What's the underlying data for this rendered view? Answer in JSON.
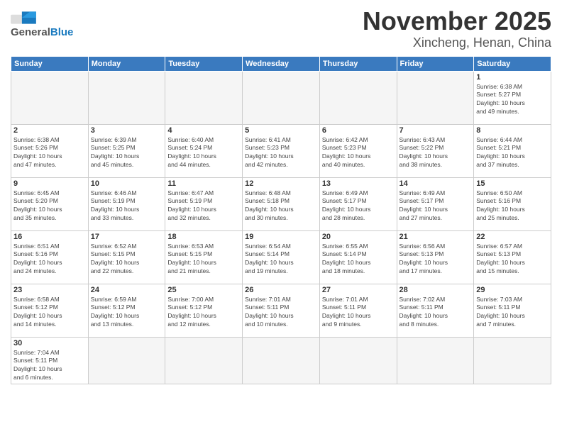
{
  "header": {
    "logo_general": "General",
    "logo_blue": "Blue",
    "month_title": "November 2025",
    "location": "Xincheng, Henan, China"
  },
  "weekdays": [
    "Sunday",
    "Monday",
    "Tuesday",
    "Wednesday",
    "Thursday",
    "Friday",
    "Saturday"
  ],
  "weeks": [
    [
      {
        "day": "",
        "info": ""
      },
      {
        "day": "",
        "info": ""
      },
      {
        "day": "",
        "info": ""
      },
      {
        "day": "",
        "info": ""
      },
      {
        "day": "",
        "info": ""
      },
      {
        "day": "",
        "info": ""
      },
      {
        "day": "1",
        "info": "Sunrise: 6:38 AM\nSunset: 5:27 PM\nDaylight: 10 hours\nand 49 minutes."
      }
    ],
    [
      {
        "day": "2",
        "info": "Sunrise: 6:38 AM\nSunset: 5:26 PM\nDaylight: 10 hours\nand 47 minutes."
      },
      {
        "day": "3",
        "info": "Sunrise: 6:39 AM\nSunset: 5:25 PM\nDaylight: 10 hours\nand 45 minutes."
      },
      {
        "day": "4",
        "info": "Sunrise: 6:40 AM\nSunset: 5:24 PM\nDaylight: 10 hours\nand 44 minutes."
      },
      {
        "day": "5",
        "info": "Sunrise: 6:41 AM\nSunset: 5:23 PM\nDaylight: 10 hours\nand 42 minutes."
      },
      {
        "day": "6",
        "info": "Sunrise: 6:42 AM\nSunset: 5:23 PM\nDaylight: 10 hours\nand 40 minutes."
      },
      {
        "day": "7",
        "info": "Sunrise: 6:43 AM\nSunset: 5:22 PM\nDaylight: 10 hours\nand 38 minutes."
      },
      {
        "day": "8",
        "info": "Sunrise: 6:44 AM\nSunset: 5:21 PM\nDaylight: 10 hours\nand 37 minutes."
      }
    ],
    [
      {
        "day": "9",
        "info": "Sunrise: 6:45 AM\nSunset: 5:20 PM\nDaylight: 10 hours\nand 35 minutes."
      },
      {
        "day": "10",
        "info": "Sunrise: 6:46 AM\nSunset: 5:19 PM\nDaylight: 10 hours\nand 33 minutes."
      },
      {
        "day": "11",
        "info": "Sunrise: 6:47 AM\nSunset: 5:19 PM\nDaylight: 10 hours\nand 32 minutes."
      },
      {
        "day": "12",
        "info": "Sunrise: 6:48 AM\nSunset: 5:18 PM\nDaylight: 10 hours\nand 30 minutes."
      },
      {
        "day": "13",
        "info": "Sunrise: 6:49 AM\nSunset: 5:17 PM\nDaylight: 10 hours\nand 28 minutes."
      },
      {
        "day": "14",
        "info": "Sunrise: 6:49 AM\nSunset: 5:17 PM\nDaylight: 10 hours\nand 27 minutes."
      },
      {
        "day": "15",
        "info": "Sunrise: 6:50 AM\nSunset: 5:16 PM\nDaylight: 10 hours\nand 25 minutes."
      }
    ],
    [
      {
        "day": "16",
        "info": "Sunrise: 6:51 AM\nSunset: 5:16 PM\nDaylight: 10 hours\nand 24 minutes."
      },
      {
        "day": "17",
        "info": "Sunrise: 6:52 AM\nSunset: 5:15 PM\nDaylight: 10 hours\nand 22 minutes."
      },
      {
        "day": "18",
        "info": "Sunrise: 6:53 AM\nSunset: 5:15 PM\nDaylight: 10 hours\nand 21 minutes."
      },
      {
        "day": "19",
        "info": "Sunrise: 6:54 AM\nSunset: 5:14 PM\nDaylight: 10 hours\nand 19 minutes."
      },
      {
        "day": "20",
        "info": "Sunrise: 6:55 AM\nSunset: 5:14 PM\nDaylight: 10 hours\nand 18 minutes."
      },
      {
        "day": "21",
        "info": "Sunrise: 6:56 AM\nSunset: 5:13 PM\nDaylight: 10 hours\nand 17 minutes."
      },
      {
        "day": "22",
        "info": "Sunrise: 6:57 AM\nSunset: 5:13 PM\nDaylight: 10 hours\nand 15 minutes."
      }
    ],
    [
      {
        "day": "23",
        "info": "Sunrise: 6:58 AM\nSunset: 5:12 PM\nDaylight: 10 hours\nand 14 minutes."
      },
      {
        "day": "24",
        "info": "Sunrise: 6:59 AM\nSunset: 5:12 PM\nDaylight: 10 hours\nand 13 minutes."
      },
      {
        "day": "25",
        "info": "Sunrise: 7:00 AM\nSunset: 5:12 PM\nDaylight: 10 hours\nand 12 minutes."
      },
      {
        "day": "26",
        "info": "Sunrise: 7:01 AM\nSunset: 5:11 PM\nDaylight: 10 hours\nand 10 minutes."
      },
      {
        "day": "27",
        "info": "Sunrise: 7:01 AM\nSunset: 5:11 PM\nDaylight: 10 hours\nand 9 minutes."
      },
      {
        "day": "28",
        "info": "Sunrise: 7:02 AM\nSunset: 5:11 PM\nDaylight: 10 hours\nand 8 minutes."
      },
      {
        "day": "29",
        "info": "Sunrise: 7:03 AM\nSunset: 5:11 PM\nDaylight: 10 hours\nand 7 minutes."
      }
    ],
    [
      {
        "day": "30",
        "info": "Sunrise: 7:04 AM\nSunset: 5:11 PM\nDaylight: 10 hours\nand 6 minutes."
      },
      {
        "day": "",
        "info": ""
      },
      {
        "day": "",
        "info": ""
      },
      {
        "day": "",
        "info": ""
      },
      {
        "day": "",
        "info": ""
      },
      {
        "day": "",
        "info": ""
      },
      {
        "day": "",
        "info": ""
      }
    ]
  ]
}
